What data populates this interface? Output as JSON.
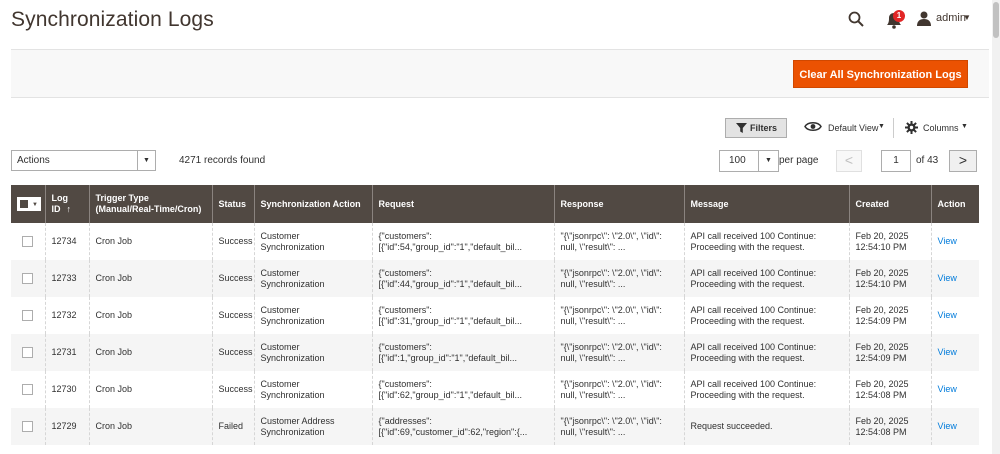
{
  "header": {
    "title": "Synchronization Logs",
    "notifications_count": "1",
    "user_label": "admin"
  },
  "action_bar": {
    "clear_button": "Clear All Synchronization Logs"
  },
  "toolbar": {
    "filters": "Filters",
    "default_view": "Default View",
    "columns": "Columns",
    "actions": "Actions",
    "records_found": "4271 records found",
    "per_page_value": "100",
    "per_page_label": "per page",
    "prev": "<",
    "next": ">",
    "page_value": "1",
    "page_of": "of 43"
  },
  "table": {
    "columns": [
      "Log ID",
      "Trigger Type (Manual/Real-Time/Cron)",
      "Status",
      "Synchronization Action",
      "Request",
      "Response",
      "Message",
      "Created",
      "Action"
    ],
    "rows": [
      {
        "id": "12734",
        "trigger": "Cron Job",
        "status": "Success",
        "action": "Customer Synchronization",
        "request": "{\"customers\":\n[{\"id\":54,\"group_id\":\"1\",\"default_bil...",
        "response": "\"{\\\"jsonrpc\\\": \\\"2.0\\\", \\\"id\\\":\nnull, \\\"result\\\": ...",
        "message": "API call received 100 Continue:\nProceeding with the request.",
        "created": "Feb 20, 2025\n12:54:10 PM",
        "link": "View"
      },
      {
        "id": "12733",
        "trigger": "Cron Job",
        "status": "Success",
        "action": "Customer Synchronization",
        "request": "{\"customers\":\n[{\"id\":44,\"group_id\":\"1\",\"default_bil...",
        "response": "\"{\\\"jsonrpc\\\": \\\"2.0\\\", \\\"id\\\":\nnull, \\\"result\\\": ...",
        "message": "API call received 100 Continue:\nProceeding with the request.",
        "created": "Feb 20, 2025\n12:54:10 PM",
        "link": "View"
      },
      {
        "id": "12732",
        "trigger": "Cron Job",
        "status": "Success",
        "action": "Customer Synchronization",
        "request": "{\"customers\":\n[{\"id\":31,\"group_id\":\"1\",\"default_bil...",
        "response": "\"{\\\"jsonrpc\\\": \\\"2.0\\\", \\\"id\\\":\nnull, \\\"result\\\": ...",
        "message": "API call received 100 Continue:\nProceeding with the request.",
        "created": "Feb 20, 2025\n12:54:09 PM",
        "link": "View"
      },
      {
        "id": "12731",
        "trigger": "Cron Job",
        "status": "Success",
        "action": "Customer Synchronization",
        "request": "{\"customers\":\n[{\"id\":1,\"group_id\":\"1\",\"default_bil...",
        "response": "\"{\\\"jsonrpc\\\": \\\"2.0\\\", \\\"id\\\":\nnull, \\\"result\\\": ...",
        "message": "API call received 100 Continue:\nProceeding with the request.",
        "created": "Feb 20, 2025\n12:54:09 PM",
        "link": "View"
      },
      {
        "id": "12730",
        "trigger": "Cron Job",
        "status": "Success",
        "action": "Customer Synchronization",
        "request": "{\"customers\":\n[{\"id\":62,\"group_id\":\"1\",\"default_bil...",
        "response": "\"{\\\"jsonrpc\\\": \\\"2.0\\\", \\\"id\\\":\nnull, \\\"result\\\": ...",
        "message": "API call received 100 Continue:\nProceeding with the request.",
        "created": "Feb 20, 2025\n12:54:08 PM",
        "link": "View"
      },
      {
        "id": "12729",
        "trigger": "Cron Job",
        "status": "Failed",
        "action": "Customer Address\nSynchronization",
        "request": "{\"addresses\":\n[{\"id\":69,\"customer_id\":62,\"region\":{...",
        "response": "\"{\\\"jsonrpc\\\": \\\"2.0\\\", \\\"id\\\":\nnull, \\\"result\\\": ...",
        "message": "Request succeeded.",
        "created": "Feb 20, 2025\n12:54:08 PM",
        "link": "View"
      }
    ]
  },
  "colors": {
    "accent": "#eb5202",
    "table_header": "#514943",
    "link": "#007bdb"
  }
}
